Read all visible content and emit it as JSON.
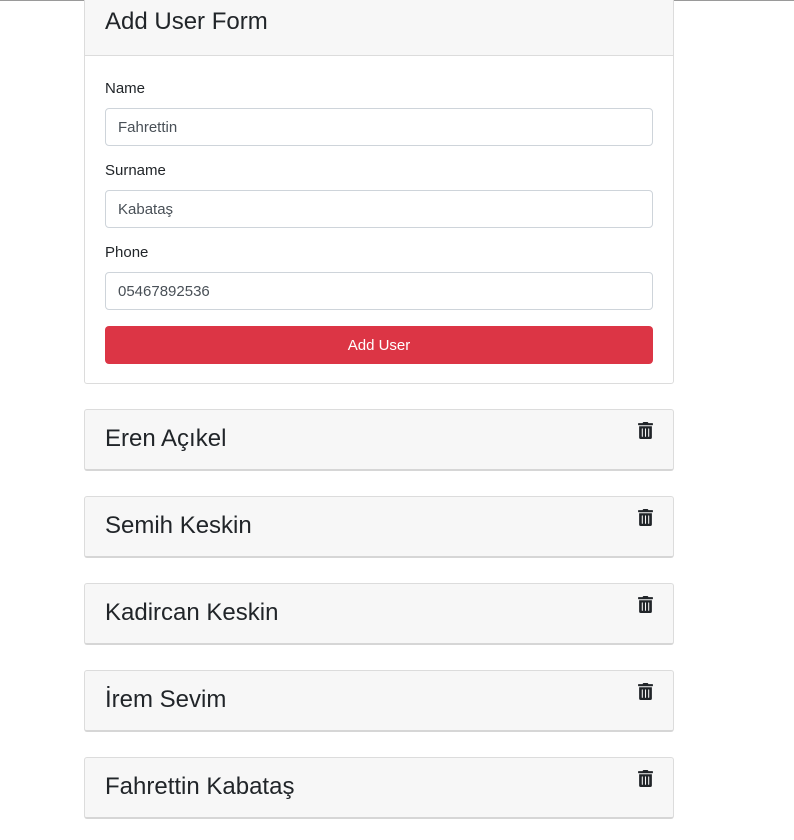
{
  "form": {
    "title": "Add User Form",
    "name_label": "Name",
    "name_value": "Fahrettin",
    "surname_label": "Surname",
    "surname_value": "Kabataş",
    "phone_label": "Phone",
    "phone_value": "05467892536",
    "submit_label": "Add User"
  },
  "users": [
    {
      "name": "Eren Açıkel",
      "icon": "trash-icon"
    },
    {
      "name": "Semih Keskin",
      "icon": "trash-icon"
    },
    {
      "name": "Kadircan Keskin",
      "icon": "trash-icon"
    },
    {
      "name": "İrem Sevim",
      "icon": "trash-icon"
    },
    {
      "name": "Fahrettin Kabataş",
      "icon": "trash-icon"
    }
  ],
  "colors": {
    "button": "#dc3545",
    "card_header": "#f7f7f7"
  }
}
